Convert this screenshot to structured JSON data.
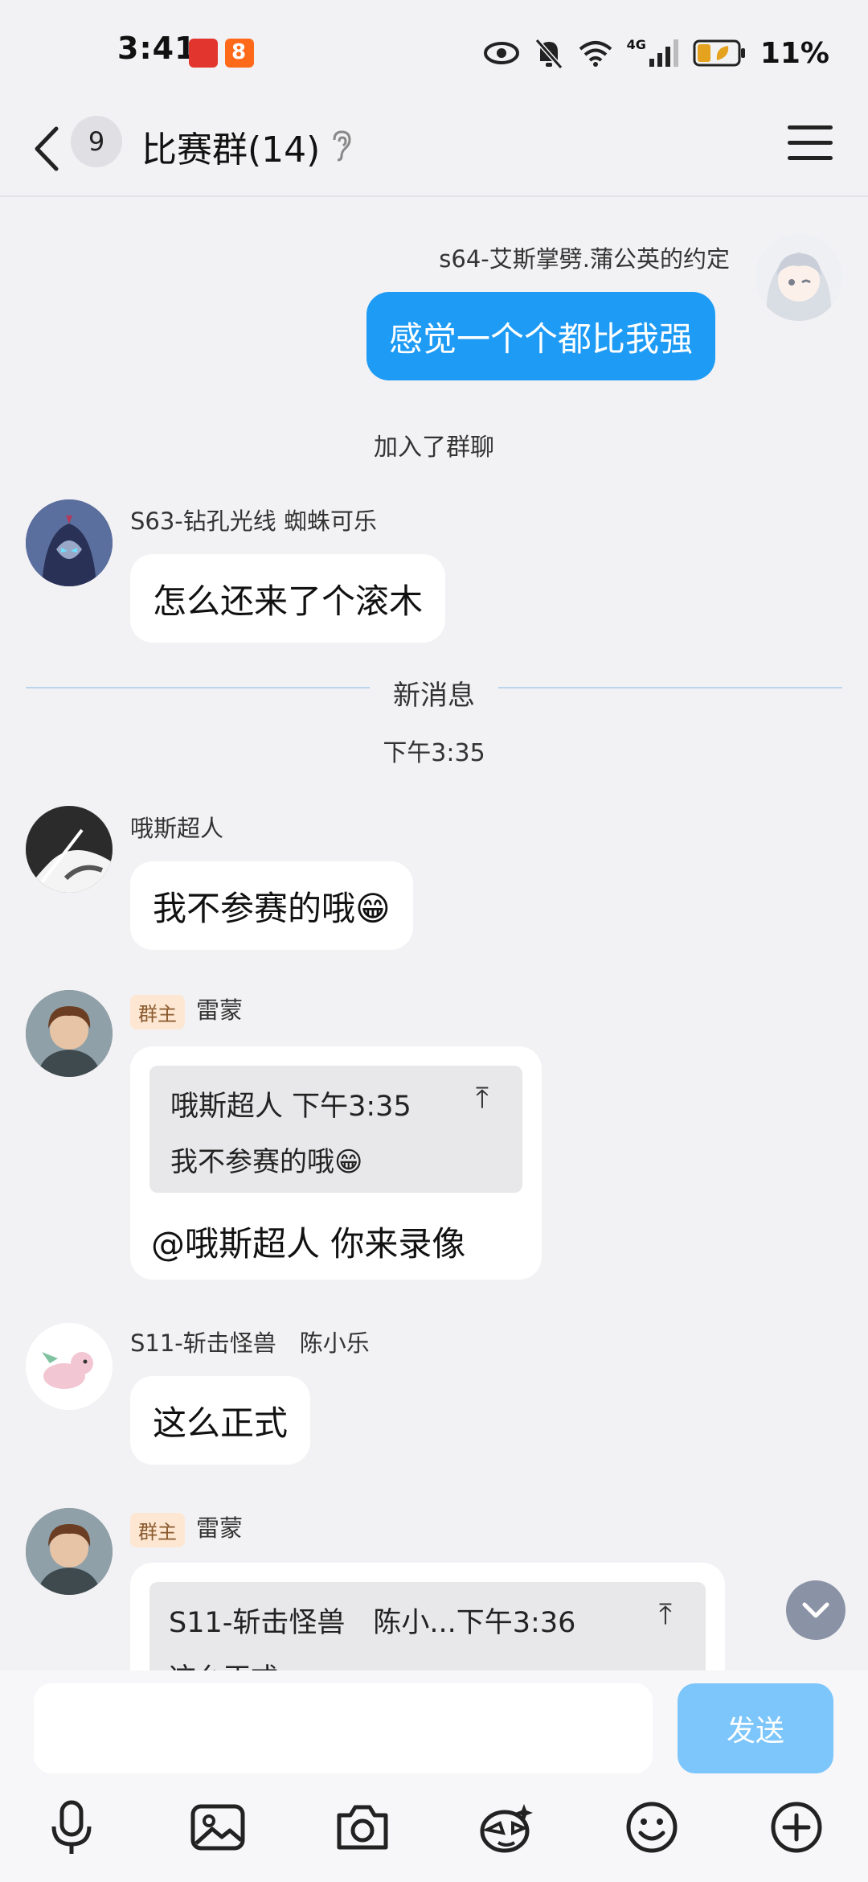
{
  "status_bar": {
    "time": "3:41",
    "battery": "11%",
    "network": "4G"
  },
  "header": {
    "unread_count": "9",
    "title": "比赛群(14)"
  },
  "messages": {
    "m1": {
      "sender": "s64-艾斯掌劈.蒲公英的约定",
      "text": "感觉一个个都比我强"
    },
    "sys_join": "加入了群聊",
    "m2": {
      "sender": "S63-钻孔光线 蜘蛛可乐",
      "text": "怎么还来了个滚木"
    },
    "new_divider": "新消息",
    "time_stamp": "下午3:35",
    "m3": {
      "sender": "哦斯超人",
      "text": "我不参赛的哦😁"
    },
    "m4": {
      "badge": "群主",
      "sender": "雷蒙",
      "quote_header": "哦斯超人 下午3:35",
      "quote_body": "我不参赛的哦😁",
      "text": "@哦斯超人 你来录像"
    },
    "m5": {
      "sender": "S11-斩击怪兽　陈小乐",
      "text": "这么正式"
    },
    "m6": {
      "badge": "群主",
      "sender": "雷蒙",
      "quote_header": "S11-斩击怪兽　陈小...下午3:36",
      "quote_body": "这么正式"
    }
  },
  "input": {
    "placeholder": "",
    "send_label": "发送"
  },
  "icons": [
    "back-icon",
    "ear-icon",
    "menu-icon",
    "mic-icon",
    "image-icon",
    "camera-icon",
    "sticker-icon",
    "emoji-icon",
    "plus-icon",
    "chevron-down-icon"
  ],
  "colors": {
    "accent": "#1e9bf5",
    "send_disabled": "#7cc6fb",
    "background": "#f2f2f4"
  }
}
